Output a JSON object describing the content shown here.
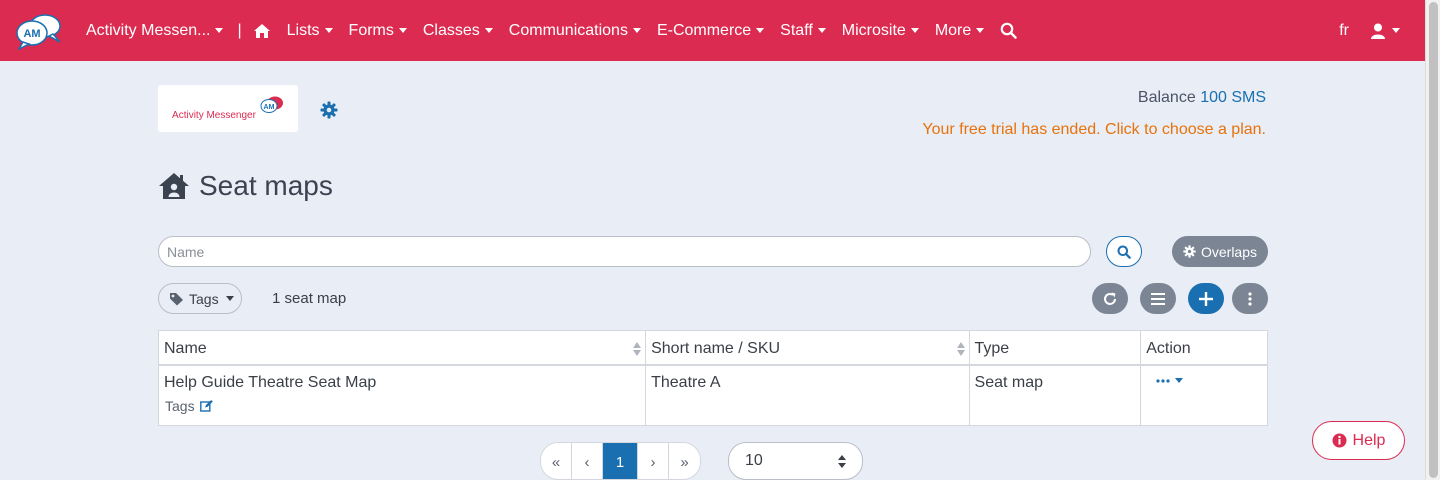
{
  "nav": {
    "brand_initials": "AM",
    "account": "Activity Messen...",
    "separator": "|",
    "items": [
      {
        "label": "Lists"
      },
      {
        "label": "Forms"
      },
      {
        "label": "Classes"
      },
      {
        "label": "Communications"
      },
      {
        "label": "E-Commerce"
      },
      {
        "label": "Staff"
      },
      {
        "label": "Microsite"
      },
      {
        "label": "More"
      }
    ],
    "lang": "fr"
  },
  "header": {
    "logo_text": "Activity Messenger",
    "logo_badge": "AM",
    "balance_label": "Balance",
    "balance_amount": "100 SMS",
    "trial_message": "Your free trial has ended. Click to choose a plan."
  },
  "page": {
    "title": "Seat maps",
    "search_placeholder": "Name",
    "overlaps_label": "Overlaps",
    "tags_label": "Tags",
    "count_text": "1 seat map"
  },
  "table": {
    "headers": [
      "Name",
      "Short name / SKU",
      "Type",
      "Action"
    ],
    "rows": [
      {
        "name": "Help Guide Theatre Seat Map",
        "tags_label": "Tags",
        "short_name": "Theatre A",
        "type": "Seat map"
      }
    ]
  },
  "pagination": {
    "first": "«",
    "prev": "‹",
    "current": "1",
    "next": "›",
    "last": "»",
    "per_page": "10"
  },
  "help": {
    "label": "Help"
  },
  "colors": {
    "primary": "#dc2b51",
    "accent": "#1a6fb0",
    "warning": "#e8720c",
    "grey_button": "#7b8594"
  }
}
